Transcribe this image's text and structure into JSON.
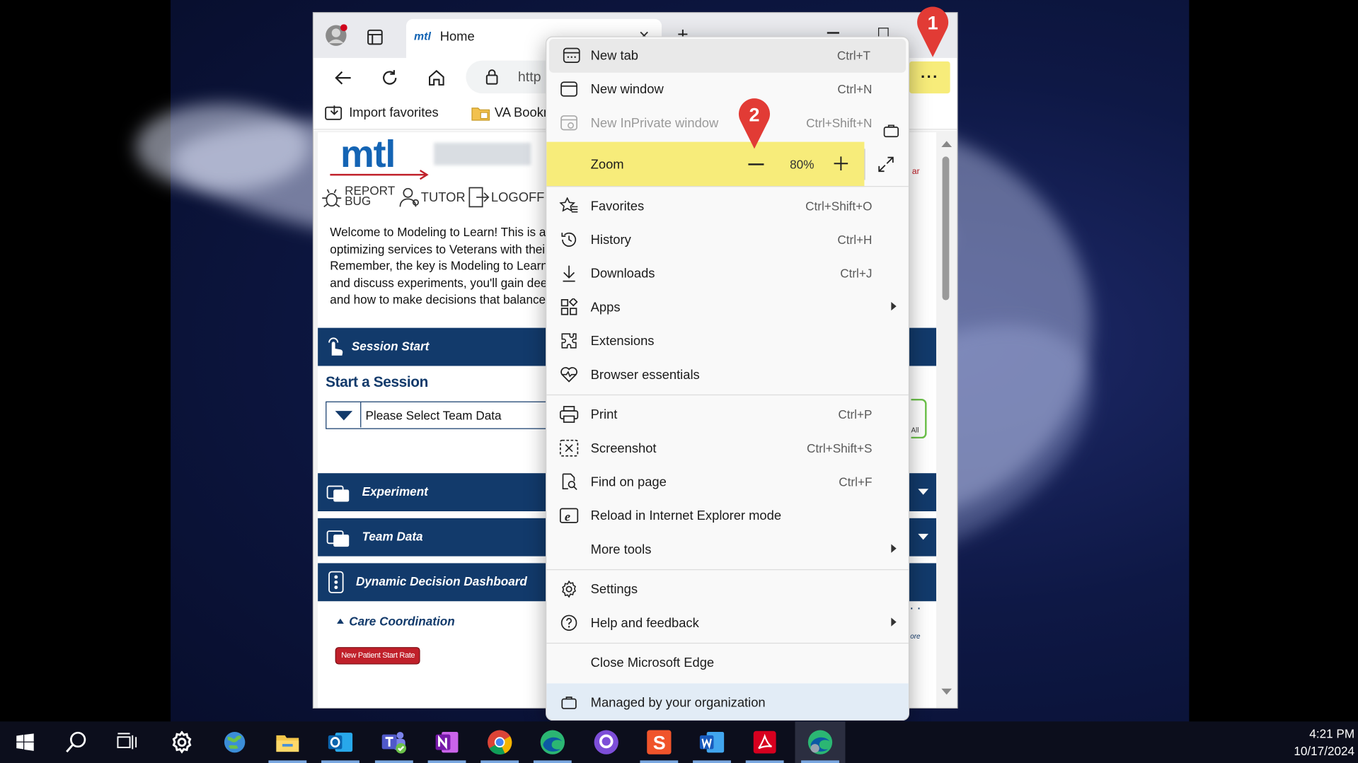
{
  "browser": {
    "tab_title": "Home",
    "tab_favicon": "mtl",
    "address_fragment": "http",
    "bookmarks": [
      "Import favorites",
      "VA Bookr"
    ]
  },
  "page": {
    "logo": "mtl",
    "nav": {
      "report_bug": "REPORT BUG",
      "tutor": "TUTOR",
      "logoff": "LOGOFF"
    },
    "intro_lines": [
      "Welcome to Modeling to Learn! This is a too",
      "optimizing services to Veterans with their ex",
      "Remember, the key is Modeling to Learn - te",
      "and discuss experiments, you'll gain deeper",
      "and how to make decisions that balance a lo"
    ],
    "session_start": "Session Start",
    "start_a_session": "Start a Session",
    "team_select": "Please Select Team Data",
    "experiment": "Experiment",
    "team_data": "Team Data",
    "dashboard": "Dynamic Decision Dashboard",
    "care_coordination": "Care Coordination",
    "new_patient_btn": "New Patient Start Rate",
    "right_ar": "ar",
    "right_all": "All",
    "right_ore": "ore"
  },
  "menu": {
    "items": [
      {
        "label": "New tab",
        "shortcut": "Ctrl+T"
      },
      {
        "label": "New window",
        "shortcut": "Ctrl+N"
      },
      {
        "label": "New InPrivate window",
        "shortcut": "Ctrl+Shift+N"
      },
      {
        "label": "Zoom",
        "value": "80%"
      },
      {
        "label": "Favorites",
        "shortcut": "Ctrl+Shift+O"
      },
      {
        "label": "History",
        "shortcut": "Ctrl+H"
      },
      {
        "label": "Downloads",
        "shortcut": "Ctrl+J"
      },
      {
        "label": "Apps"
      },
      {
        "label": "Extensions"
      },
      {
        "label": "Browser essentials"
      },
      {
        "label": "Print",
        "shortcut": "Ctrl+P"
      },
      {
        "label": "Screenshot",
        "shortcut": "Ctrl+Shift+S"
      },
      {
        "label": "Find on page",
        "shortcut": "Ctrl+F"
      },
      {
        "label": "Reload in Internet Explorer mode"
      },
      {
        "label": "More tools"
      },
      {
        "label": "Settings"
      },
      {
        "label": "Help and feedback"
      },
      {
        "label": "Close Microsoft Edge"
      },
      {
        "label": "Managed by your organization"
      }
    ]
  },
  "callouts": {
    "one": "1",
    "two": "2"
  },
  "taskbar": {
    "time": "4:21 PM",
    "date": "10/17/2024"
  },
  "colors": {
    "highlight": "#f7ec7a",
    "navy": "#123a6b",
    "callout": "#e23b35",
    "logo_blue": "#1464b4",
    "logo_red": "#c0202a"
  }
}
